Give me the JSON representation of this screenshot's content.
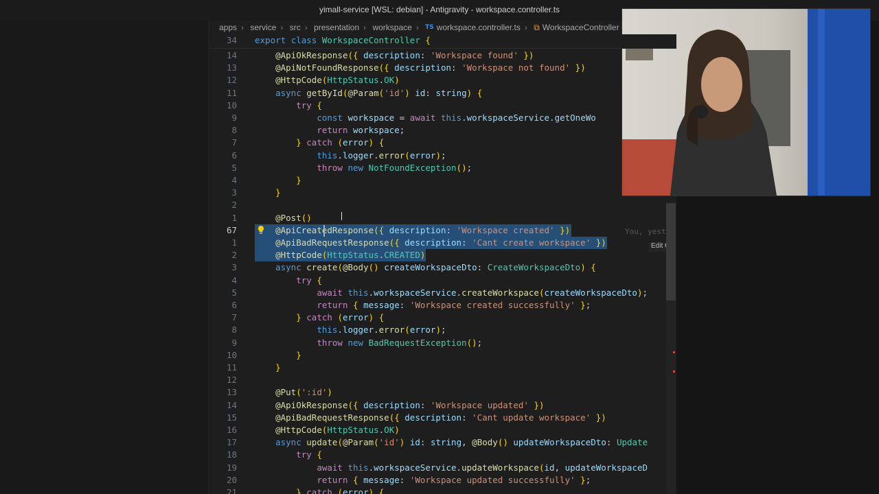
{
  "window": {
    "title": "yimall-service [WSL: debian] - Antigravity - workspace.controller.ts"
  },
  "breadcrumb": {
    "items": [
      "apps",
      "service",
      "src",
      "presentation",
      "workspace"
    ],
    "file_icon": "TS",
    "file": "workspace.controller.ts",
    "symbol": "WorkspaceController"
  },
  "sticky": {
    "line_number": "34",
    "text": "export class WorkspaceController {"
  },
  "lines": [
    {
      "n": "14",
      "text": "    @ApiOkResponse({ description: 'Workspace found' })"
    },
    {
      "n": "13",
      "text": "    @ApiNotFoundResponse({ description: 'Workspace not found' })"
    },
    {
      "n": "12",
      "text": "    @HttpCode(HttpStatus.OK)"
    },
    {
      "n": "11",
      "text": "    async getById(@Param('id') id: string) {"
    },
    {
      "n": "10",
      "text": "        try {"
    },
    {
      "n": "9",
      "text": "            const workspace = await this.workspaceService.getOneWo"
    },
    {
      "n": "8",
      "text": "            return workspace;"
    },
    {
      "n": "7",
      "text": "        } catch (error) {"
    },
    {
      "n": "6",
      "text": "            this.logger.error(error);"
    },
    {
      "n": "5",
      "text": "            throw new NotFoundException();"
    },
    {
      "n": "4",
      "text": "        }"
    },
    {
      "n": "3",
      "text": "    }"
    },
    {
      "n": "2",
      "text": ""
    },
    {
      "n": "1",
      "text": "    @Post()"
    },
    {
      "n": "67",
      "text": "    @ApiCreatedResponse({ description: 'Workspace created' })"
    },
    {
      "n": "1",
      "text": "    @ApiBadRequestResponse({ description: 'Cant create workspace' })"
    },
    {
      "n": "2",
      "text": "    @HttpCode(HttpStatus.CREATED)"
    },
    {
      "n": "3",
      "text": "    async create(@Body() createWorkspaceDto: CreateWorkspaceDto) {"
    },
    {
      "n": "4",
      "text": "        try {"
    },
    {
      "n": "5",
      "text": "            await this.workspaceService.createWorkspace(createWorkspaceDto);"
    },
    {
      "n": "6",
      "text": "            return { message: 'Workspace created successfully' };"
    },
    {
      "n": "7",
      "text": "        } catch (error) {"
    },
    {
      "n": "8",
      "text": "            this.logger.error(error);"
    },
    {
      "n": "9",
      "text": "            throw new BadRequestException();"
    },
    {
      "n": "10",
      "text": "        }"
    },
    {
      "n": "11",
      "text": "    }"
    },
    {
      "n": "12",
      "text": ""
    },
    {
      "n": "13",
      "text": "    @Put(':id')"
    },
    {
      "n": "14",
      "text": "    @ApiOkResponse({ description: 'Workspace updated' })"
    },
    {
      "n": "15",
      "text": "    @ApiBadRequestResponse({ description: 'Cant update workspace' })"
    },
    {
      "n": "16",
      "text": "    @HttpCode(HttpStatus.OK)"
    },
    {
      "n": "17",
      "text": "    async update(@Param('id') id: string, @Body() updateWorkspaceDto: Update"
    },
    {
      "n": "18",
      "text": "        try {"
    },
    {
      "n": "19",
      "text": "            await this.workspaceService.updateWorkspace(id, updateWorkspaceD"
    },
    {
      "n": "20",
      "text": "            return { message: 'Workspace updated successfully' };"
    },
    {
      "n": "21",
      "text": "        } catch (error) {"
    }
  ],
  "active_line_index": 14,
  "selection_lines": [
    14,
    15,
    16
  ],
  "inline_blame": "You, yest",
  "edit_chip": "Edit Ct",
  "colors": {
    "selection": "#264f78",
    "keyword": "#569cd6",
    "string": "#ce9178",
    "function": "#dcdcaa",
    "class": "#4ec9b0"
  },
  "icons": [
    "lightbulb-icon",
    "ts-file-icon",
    "class-symbol-icon",
    "chevron-right-icon"
  ],
  "webcam": {
    "present": true
  }
}
